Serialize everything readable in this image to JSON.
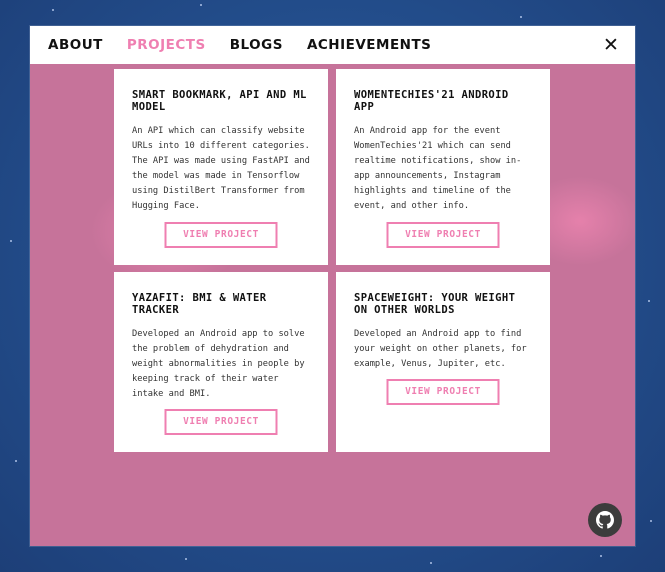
{
  "nav": {
    "items": [
      {
        "label": "ABOUT",
        "active": false
      },
      {
        "label": "PROJECTS",
        "active": true
      },
      {
        "label": "BLOGS",
        "active": false
      },
      {
        "label": "ACHIEVEMENTS",
        "active": false
      }
    ],
    "close_icon": "close-icon",
    "close_glyph": "✕"
  },
  "projects": [
    {
      "title": "SMART BOOKMARK, API AND ML MODEL",
      "description": "An API which can classify website URLs into 10 different categories. The API was made using FastAPI and the model was made in Tensorflow using DistilBert Transformer from Hugging Face.",
      "button": "VIEW PROJECT"
    },
    {
      "title": "WOMENTECHIES'21 ANDROID APP",
      "description": "An Android app for the event WomenTechies'21 which can send realtime notifications, show in-app announcements, Instagram highlights and timeline of the event, and other info.",
      "button": "VIEW PROJECT"
    },
    {
      "title": "YAZAFIT: BMI & WATER TRACKER",
      "description": "Developed an Android app to solve the problem of dehydration and weight abnormalities in people by keeping track of their water intake and BMI.",
      "button": "VIEW PROJECT"
    },
    {
      "title": "SPACEWEIGHT: YOUR WEIGHT ON OTHER WORLDS",
      "description": "Developed an Android app to find your weight on other planets, for example, Venus, Jupiter, etc.",
      "button": "VIEW PROJECT"
    }
  ],
  "github_button": {
    "icon": "github-icon"
  },
  "colors": {
    "accent": "#ef7fb1",
    "window_bg": "#c6739a",
    "page_bg": "#24508f"
  }
}
